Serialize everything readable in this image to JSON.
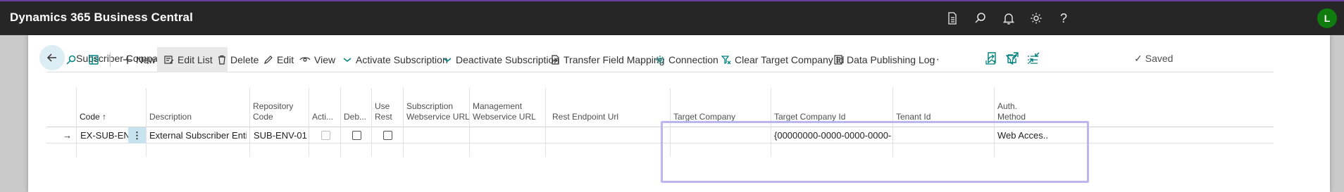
{
  "app": {
    "title": "Dynamics 365 Business Central",
    "avatar_initial": "L"
  },
  "topbar_icons": [
    "document-icon",
    "search-icon",
    "bell-icon",
    "gear-icon",
    "help-icon"
  ],
  "page": {
    "title": "Subscriber Company List",
    "status": "Saved"
  },
  "actions": {
    "new": "New",
    "edit_list": "Edit List",
    "delete": "Delete",
    "edit": "Edit",
    "view": "View",
    "activate": "Activate Subscription",
    "deactivate": "Deactivate Subscription",
    "transfer": "Transfer Field Mapping",
    "connection": "Connection",
    "clear_target": "Clear Target Company Id",
    "data_log": "Data Publishing Log",
    "more": "···"
  },
  "columns": {
    "code": "Code",
    "sort_indicator": "↑",
    "description": "Description",
    "repository_code_1": "Repository",
    "repository_code_2": "Code",
    "active": "Acti...",
    "debug": "Deb...",
    "use_rest_1": "Use",
    "use_rest_2": "Rest",
    "sub_ws_url_1": "Subscription",
    "sub_ws_url_2": "Webservice URL",
    "mgmt_ws_url_1": "Management",
    "mgmt_ws_url_2": "Webservice URL",
    "rest_endpoint": "Rest Endpoint Url",
    "target_company": "Target Company",
    "target_company_id": "Target Company Id",
    "tenant_id": "Tenant Id",
    "auth_method_1": "Auth.",
    "auth_method_2": "Method"
  },
  "rows": [
    {
      "code": "EX-SUB-ENT",
      "description": "External Subscriber Entity",
      "repository_code": "SUB-ENV-01",
      "active": false,
      "debug": false,
      "use_rest": false,
      "sub_ws_url": "",
      "mgmt_ws_url": "",
      "rest_endpoint": "",
      "target_company": "",
      "target_company_id": "{00000000-0000-0000-0000-0...",
      "tenant_id": "",
      "auth_method": "Web Acces..."
    }
  ],
  "colors": {
    "accent": "#00827f",
    "appbar": "#262626",
    "highlight": "#bdb5f0",
    "avatar": "#107c10"
  }
}
